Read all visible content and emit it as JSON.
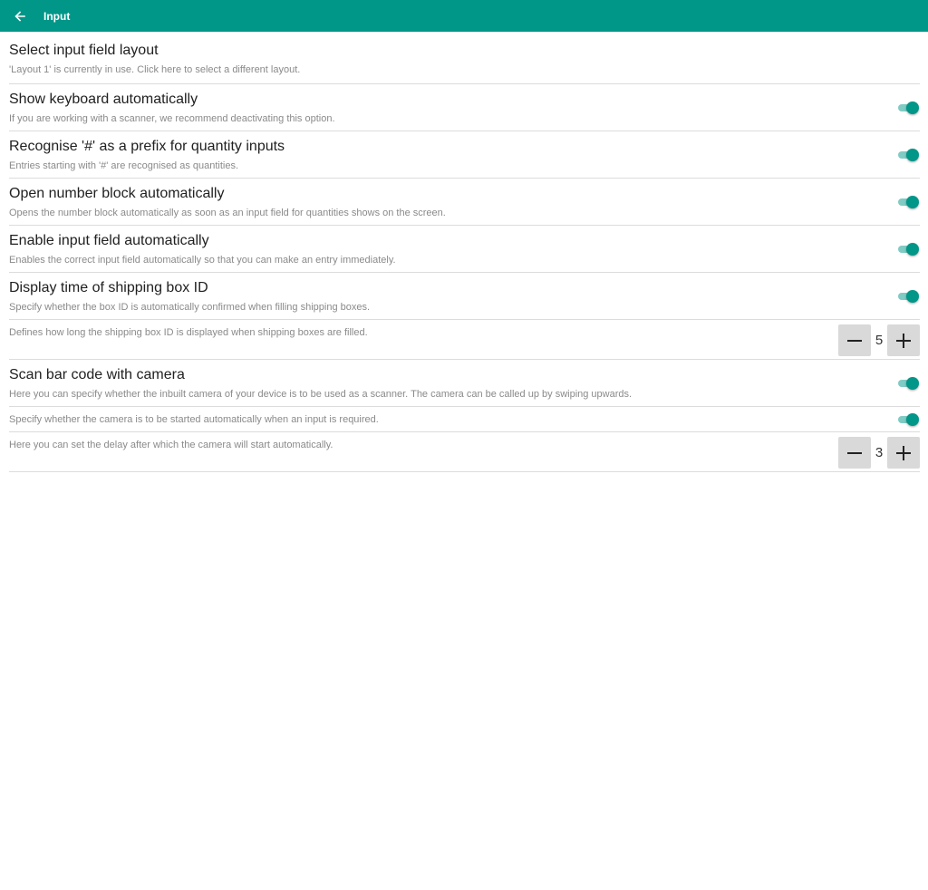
{
  "appbar": {
    "title": "Input",
    "back_icon": "arrow-left-icon"
  },
  "colors": {
    "primary": "#009688",
    "toggle_track": "#80cbc4",
    "divider": "#dcdcdc"
  },
  "settings": {
    "layout": {
      "title": "Select input field layout",
      "subtitle": "'Layout 1' is currently in use. Click here to select a different layout."
    },
    "keyboard": {
      "title": "Show keyboard automatically",
      "subtitle": "If you are working with a scanner, we recommend deactivating this option.",
      "enabled": true
    },
    "prefix": {
      "title": "Recognise '#' as a prefix for quantity inputs",
      "subtitle": "Entries starting with '#' are recognised as quantities.",
      "enabled": true
    },
    "numblock": {
      "title": "Open number block automatically",
      "subtitle": "Opens the number block automatically as soon as an input field for quantities shows on the screen.",
      "enabled": true
    },
    "enable_field": {
      "title": "Enable input field automatically",
      "subtitle": "Enables the correct input field automatically so that you can make an entry immediately.",
      "enabled": true
    },
    "box_id": {
      "title": "Display time of shipping box ID",
      "subtitle": "Specify whether the box ID is automatically confirmed when filling shipping boxes.",
      "enabled": true
    },
    "box_id_duration": {
      "subtitle": "Defines how long the shipping box ID is displayed when shipping boxes are filled.",
      "value": "5"
    },
    "camera": {
      "title": "Scan bar code with camera",
      "subtitle": "Here you can specify whether the inbuilt camera of your device is to be used as a scanner. The camera can be called up by swiping upwards.",
      "enabled": true
    },
    "camera_auto": {
      "subtitle": "Specify whether the camera is to be started automatically when an input is required.",
      "enabled": true
    },
    "camera_delay": {
      "subtitle": "Here you can set the delay after which the camera will start automatically.",
      "value": "3"
    }
  }
}
